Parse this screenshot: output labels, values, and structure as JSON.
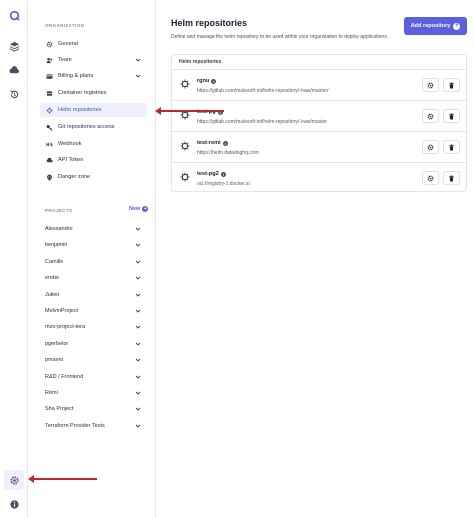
{
  "sidebar_rail": {
    "items": [
      {
        "icon": "logo-icon"
      },
      {
        "icon": "layers-icon"
      },
      {
        "icon": "cloud-icon"
      },
      {
        "icon": "history-icon"
      },
      {
        "icon": "gear-icon"
      },
      {
        "icon": "info-icon"
      }
    ]
  },
  "nav": {
    "section_title": "ORGANIZATION",
    "items": [
      {
        "label": "General",
        "icon": "gear-icon"
      },
      {
        "label": "Team",
        "icon": "users-icon"
      },
      {
        "label": "Billing & plans",
        "icon": "card-icon"
      },
      {
        "label": "Container registries",
        "icon": "box-icon"
      },
      {
        "label": "Helm repositories",
        "icon": "helm-icon"
      },
      {
        "label": "Git repositories access",
        "icon": "key-icon"
      },
      {
        "label": "Webhook",
        "icon": "webhook-icon"
      },
      {
        "label": "API Token",
        "icon": "cloud-icon"
      },
      {
        "label": "Danger zone",
        "icon": "skull-icon"
      }
    ],
    "projects_title": "PROJECTS",
    "new_label": "New",
    "projects": [
      "Alessandro",
      "benjamin",
      "Camille",
      "erebe",
      "Julien",
      "MelvinProject",
      "mzo-project-tera",
      "pgerbelor",
      "pmavro",
      "R&D / Frontend",
      "Rémi",
      "Sha Project",
      "Terraform Provider Tests"
    ]
  },
  "main": {
    "title": "Helm repositories",
    "description": "Define and manage the helm repository to be used within your organization to deploy applications.",
    "add_button_label": "Add repository",
    "card_header": "Helm repositories",
    "repositories": [
      {
        "name": "rgnu",
        "url": "https://gitlab.com/mulesoft-int/helm-repository/-/raw/master/"
      },
      {
        "name": "test-pg",
        "url": "https://gitlab.com/mulesoft-int/helm-repository/-/raw/master"
      },
      {
        "name": "test-remi",
        "url": "https://helm.datadoghq.com"
      },
      {
        "name": "test-pg2",
        "url": "oci://registry-1.docker.io"
      }
    ]
  },
  "colors": {
    "accent": "#5b5fe0",
    "annotation": "#c0262d",
    "active_bg": "#eef0fb"
  }
}
